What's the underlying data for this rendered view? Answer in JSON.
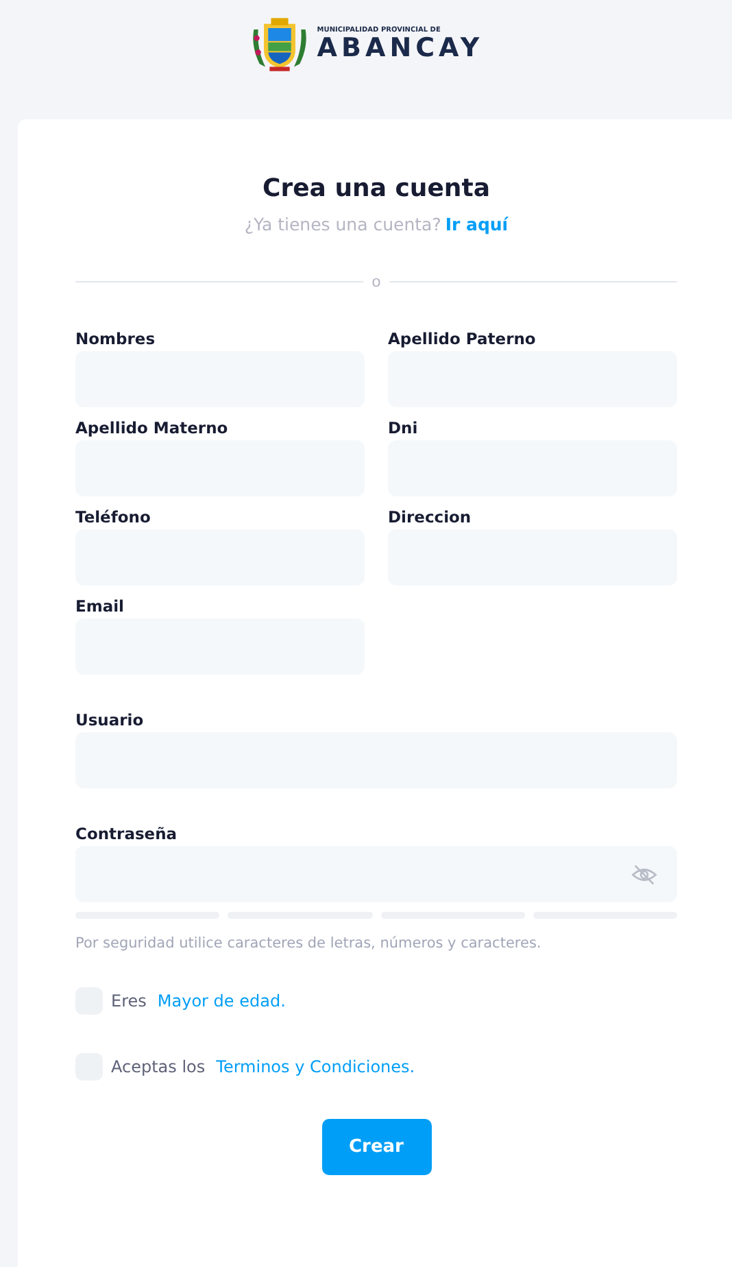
{
  "logo": {
    "subtitle": "MUNICIPALIDAD PROVINCIAL DE",
    "name": "ABANCAY"
  },
  "title": "Crea una cuenta",
  "login_prompt": {
    "text": "¿Ya tienes una cuenta?",
    "link": "Ir aquí"
  },
  "divider_text": "o",
  "fields": [
    {
      "label": "Nombres",
      "kind": "half"
    },
    {
      "label": "Apellido Paterno",
      "kind": "half"
    },
    {
      "label": "Apellido Materno",
      "kind": "half"
    },
    {
      "label": "Dni",
      "kind": "half"
    },
    {
      "label": "Teléfono",
      "kind": "half"
    },
    {
      "label": "Direccion",
      "kind": "half"
    },
    {
      "label": "Email",
      "kind": "half"
    },
    {
      "label": "Usuario",
      "kind": "full"
    }
  ],
  "password": {
    "label": "Contraseña",
    "hint": "Por seguridad utilice caracteres de letras, números y caracteres."
  },
  "checkboxes": [
    {
      "text": "Eres",
      "link": "Mayor de edad.",
      "checked": false
    },
    {
      "text": "Aceptas los",
      "link": "Terminos y Condiciones.",
      "checked": false
    }
  ],
  "submit": "Crear"
}
